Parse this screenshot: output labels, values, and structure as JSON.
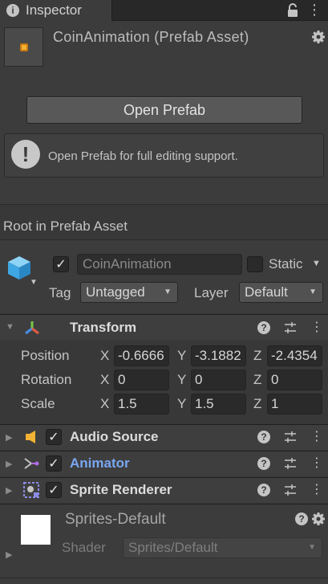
{
  "tab": {
    "icon": "info-icon",
    "label": "Inspector"
  },
  "asset": {
    "title": "CoinAnimation (Prefab Asset)"
  },
  "open_prefab": {
    "label": "Open Prefab"
  },
  "helpbox": {
    "text": "Open Prefab for full editing support."
  },
  "root_label": "Root in Prefab Asset",
  "gameobject": {
    "name": "CoinAnimation",
    "active": true,
    "static_label": "Static",
    "tag_label": "Tag",
    "tag_value": "Untagged",
    "layer_label": "Layer",
    "layer_value": "Default"
  },
  "transform": {
    "title": "Transform",
    "position": {
      "label": "Position",
      "x": "-0.6666",
      "y": "-3.1882",
      "z": "-2.4354"
    },
    "rotation": {
      "label": "Rotation",
      "x": "0",
      "y": "0",
      "z": "0"
    },
    "scale": {
      "label": "Scale",
      "x": "1.5",
      "y": "1.5",
      "z": "1"
    },
    "axes": {
      "x": "X",
      "y": "Y",
      "z": "Z"
    }
  },
  "components": {
    "audio_source": {
      "title": "Audio Source",
      "enabled": true
    },
    "animator": {
      "title": "Animator",
      "enabled": true,
      "color": "#7aa7f2"
    },
    "sprite_renderer": {
      "title": "Sprite Renderer",
      "enabled": true
    }
  },
  "material": {
    "name": "Sprites-Default",
    "shader_label": "Shader",
    "shader_value": "Sprites/Default"
  },
  "colors": {
    "background": "#383838",
    "header": "#3c3c3c",
    "field": "#2a2a2a",
    "accent": "#7aa7f2"
  }
}
